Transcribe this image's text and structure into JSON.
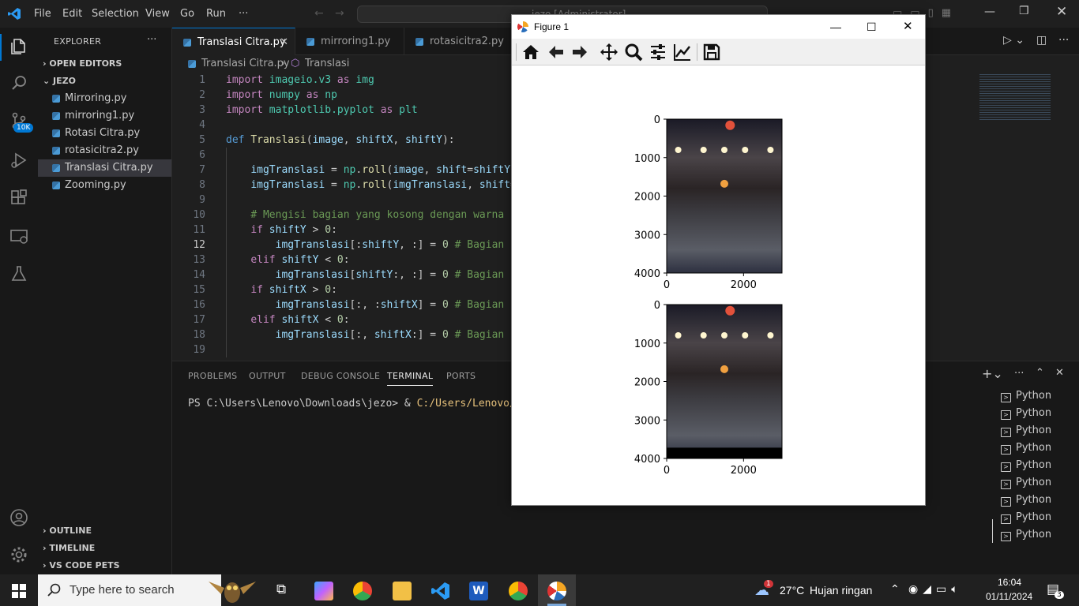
{
  "titlebar": {
    "menus": [
      "File",
      "Edit",
      "Selection",
      "View",
      "Go",
      "Run",
      "···"
    ],
    "command_center": "jezo [Administrator]"
  },
  "sidebar": {
    "header": "EXPLORER",
    "more": "···",
    "open_editors": "OPEN EDITORS",
    "folder": "JEZO",
    "files": [
      "Mirroring.py",
      "mirroring1.py",
      "Rotasi Citra.py",
      "rotasicitra2.py",
      "Translasi Citra.py",
      "Zooming.py"
    ],
    "outline": "OUTLINE",
    "timeline": "TIMELINE",
    "vscode_pets": "VS CODE PETS",
    "source_control_badge": "10K"
  },
  "tabs": [
    "Translasi Citra.py",
    "mirroring1.py",
    "rotasicitra2.py"
  ],
  "breadcrumb": {
    "file": "Translasi Citra.py",
    "symbol": "Translasi"
  },
  "editor": {
    "line_numbers": [
      "1",
      "2",
      "3",
      "4",
      "5",
      "6",
      "7",
      "8",
      "9",
      "10",
      "11",
      "12",
      "13",
      "14",
      "15",
      "16",
      "17",
      "18",
      "19"
    ],
    "current_line": "12"
  },
  "panel": {
    "tabs": [
      "PROBLEMS",
      "OUTPUT",
      "DEBUG CONSOLE",
      "TERMINAL",
      "PORTS"
    ],
    "active_tab": "TERMINAL",
    "terminal_prompt": "PS C:\\Users\\Lenovo\\Downloads\\jezo> & ",
    "terminal_cmd": "C:/Users/Lenovo/anacon",
    "terminals": [
      "Python",
      "Python",
      "Python",
      "Python",
      "Python",
      "Python",
      "Python",
      "Python",
      "Python"
    ]
  },
  "figure": {
    "title": "Figure 1",
    "toolbar": [
      "home",
      "back",
      "forward",
      "pan",
      "zoom",
      "configure-subplots",
      "edit-axes",
      "save"
    ]
  },
  "chart_data": [
    {
      "type": "image",
      "title": "",
      "xlabel": "",
      "ylabel": "",
      "xticks": [
        "0",
        "2000"
      ],
      "yticks": [
        "0",
        "1000",
        "2000",
        "3000",
        "4000"
      ],
      "xlim": [
        0,
        3000
      ],
      "ylim": [
        4000,
        0
      ]
    },
    {
      "type": "image",
      "title": "",
      "xlabel": "",
      "ylabel": "",
      "xticks": [
        "0",
        "2000"
      ],
      "yticks": [
        "0",
        "1000",
        "2000",
        "3000",
        "4000"
      ],
      "xlim": [
        0,
        3000
      ],
      "ylim": [
        4000,
        0
      ]
    }
  ],
  "taskbar": {
    "search_placeholder": "Type here to search",
    "weather_temp": "27°C",
    "weather_desc": "Hujan ringan",
    "weather_badge": "1",
    "time": "16:04",
    "date": "01/11/2024",
    "notification_count": "3"
  },
  "colors": {
    "accent": "#0078d4",
    "editor_bg": "#1f1f1f",
    "sidebar_bg": "#181818"
  }
}
